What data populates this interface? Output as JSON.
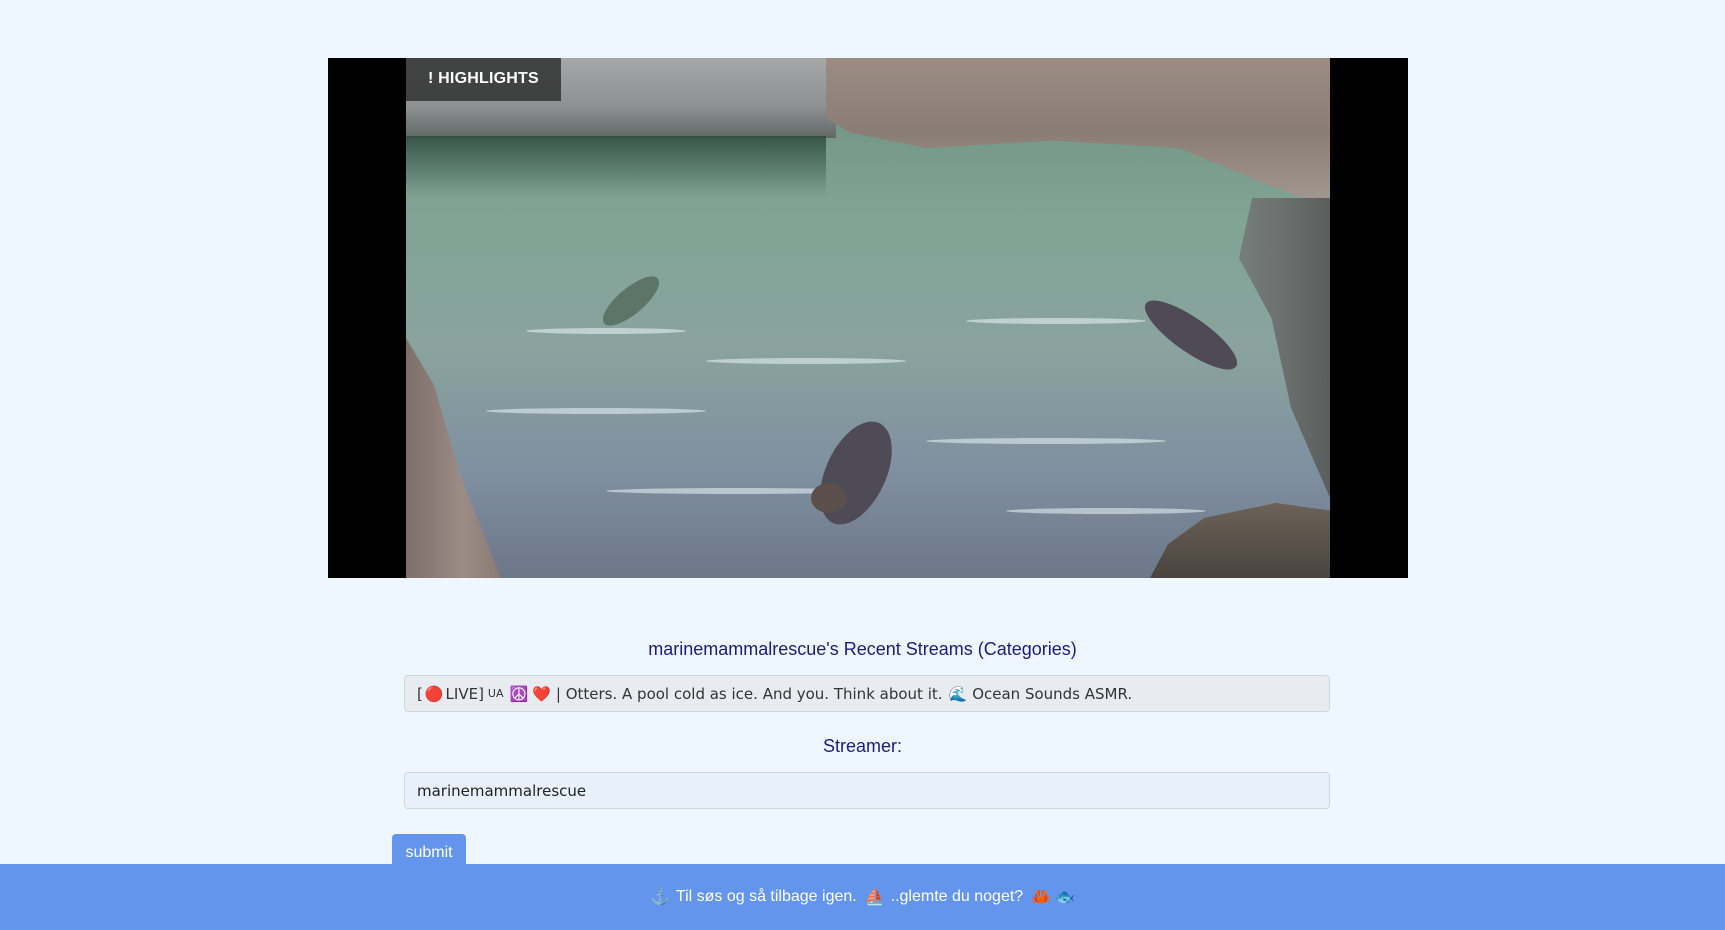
{
  "player": {
    "badge_label": "! HIGHLIGHTS"
  },
  "streams": {
    "title": "marinemammalrescue's Recent Streams (Categories)",
    "prefix": "[",
    "live_icon": "🔴",
    "live_label": "LIVE]",
    "ua_label": "UA",
    "peace_icon": "☮️",
    "heart_icon": "❤️",
    "text": "| Otters. A pool cold as ice. And you. Think about it.",
    "wave_icon": "🌊",
    "suffix": "Ocean Sounds ASMR."
  },
  "form": {
    "streamer_label": "Streamer:",
    "streamer_value": "marinemammalrescue",
    "submit_label": "submit"
  },
  "footer": {
    "anchor_icon": "⚓",
    "text1": "Til søs og så tilbage igen.",
    "sailboat_icon": "⛵",
    "text2": "..glemte du noget?",
    "crab_icon": "🦀",
    "fish_icon": "🐟"
  },
  "colors": {
    "background": "#eef6ff",
    "accent": "#6495ed",
    "title": "#1c1c7a"
  }
}
